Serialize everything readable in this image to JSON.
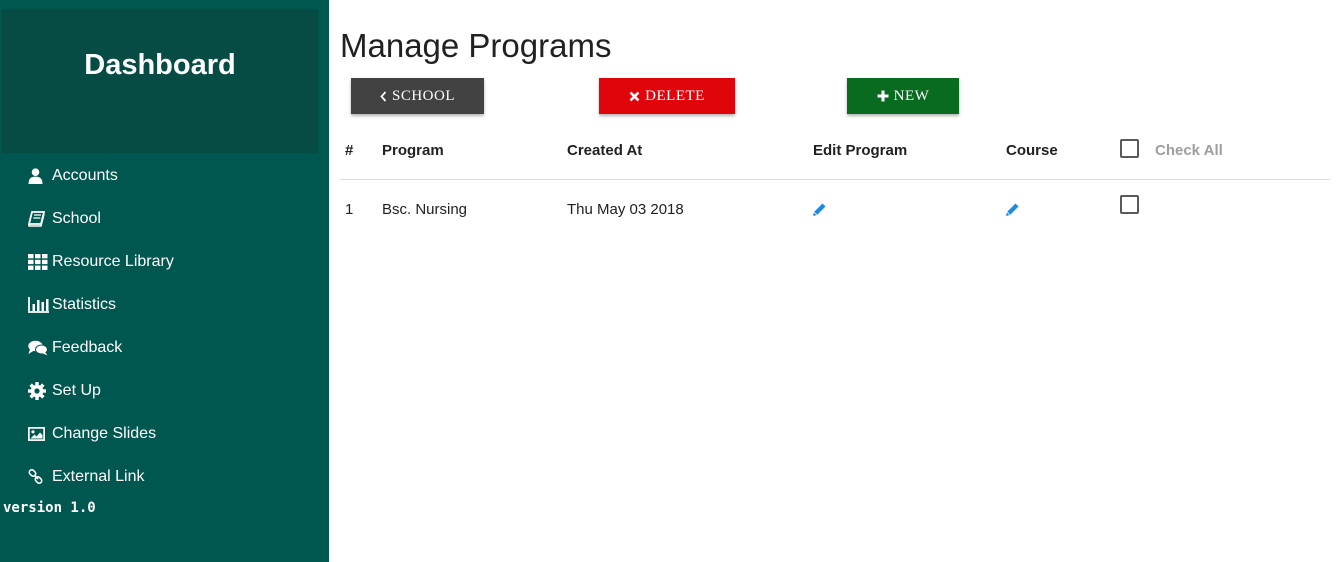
{
  "sidebar": {
    "title": "Dashboard",
    "items": [
      {
        "label": "Accounts",
        "icon": "user-icon"
      },
      {
        "label": "School",
        "icon": "book-icon"
      },
      {
        "label": "Resource Library",
        "icon": "grid-icon"
      },
      {
        "label": "Statistics",
        "icon": "bar-chart-icon"
      },
      {
        "label": "Feedback",
        "icon": "comments-icon"
      },
      {
        "label": "Set Up",
        "icon": "gear-icon"
      },
      {
        "label": "Change Slides",
        "icon": "image-icon"
      },
      {
        "label": "External Link",
        "icon": "link-icon"
      }
    ],
    "version": "version 1.0"
  },
  "main": {
    "title": "Manage Programs",
    "buttons": {
      "school": "SCHOOL",
      "delete": "DELETE",
      "new": "NEW"
    },
    "table": {
      "headers": {
        "index": "#",
        "program": "Program",
        "created_at": "Created At",
        "edit_program": "Edit Program",
        "course": "Course",
        "check_all": "Check All"
      },
      "rows": [
        {
          "index": "1",
          "program": "Bsc. Nursing",
          "created_at": "Thu May 03 2018"
        }
      ]
    }
  },
  "colors": {
    "sidebar_bg": "#00574f",
    "sidebar_header_bg": "#064c45",
    "school_button": "#424242",
    "delete_button": "#e0040b",
    "new_button": "#086b20",
    "edit_icon": "#1e88e5"
  }
}
